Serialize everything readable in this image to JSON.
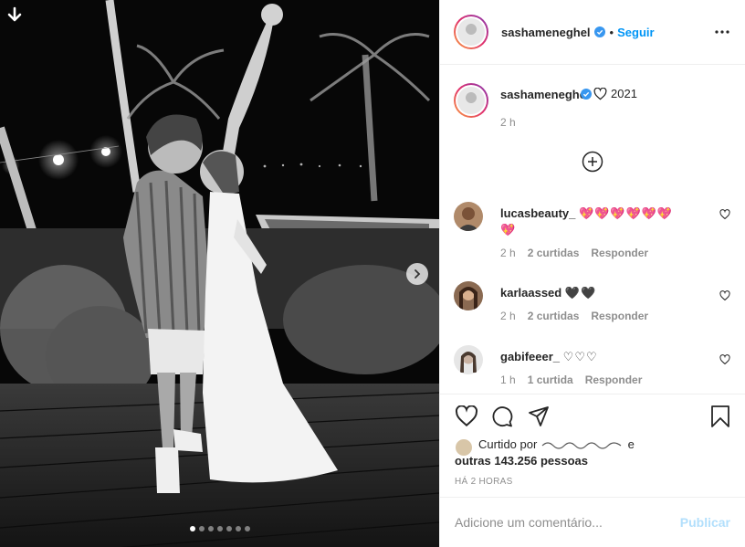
{
  "post": {
    "author": "sashameneghel",
    "follow_label": "Seguir",
    "separator": "•",
    "more_icon": "more-horizontal-icon",
    "caption": {
      "username": "sashameneghel",
      "text": "2021",
      "heart_icon": "heart-outline-icon",
      "time": "2 h"
    },
    "load_more_icon": "plus-circle-icon",
    "comments": [
      {
        "username": "lucasbeauty_",
        "text": "💖💖💖💖💖💖💖",
        "time": "2 h",
        "likes": "2 curtidas",
        "reply": "Responder"
      },
      {
        "username": "karlaassed",
        "text": "🖤🖤",
        "time": "2 h",
        "likes": "2 curtidas",
        "reply": "Responder"
      },
      {
        "username": "gabifeeer_",
        "text": "♡♡♡",
        "time": "1 h",
        "likes": "1 curtida",
        "reply": "Responder"
      }
    ],
    "actions": {
      "like_icon": "heart-icon",
      "comment_icon": "comment-icon",
      "share_icon": "paper-plane-icon",
      "save_icon": "bookmark-icon"
    },
    "liked_by": {
      "prefix": "Curtido por",
      "suffix": "e",
      "others": "outras 143.256 pessoas"
    },
    "time_ago": "HÁ 2 HORAS",
    "comment_placeholder": "Adicione um comentário...",
    "publish_label": "Publicar"
  },
  "carousel": {
    "slide_count": 7,
    "active_index": 0,
    "download_icon": "arrow-down-icon",
    "next_icon": "chevron-right-icon"
  },
  "colors": {
    "link_blue": "#0095f6",
    "publish_disabled": "#b2dffc",
    "secondary_text": "#8e8e8e",
    "heart_red": "#ed4956"
  }
}
